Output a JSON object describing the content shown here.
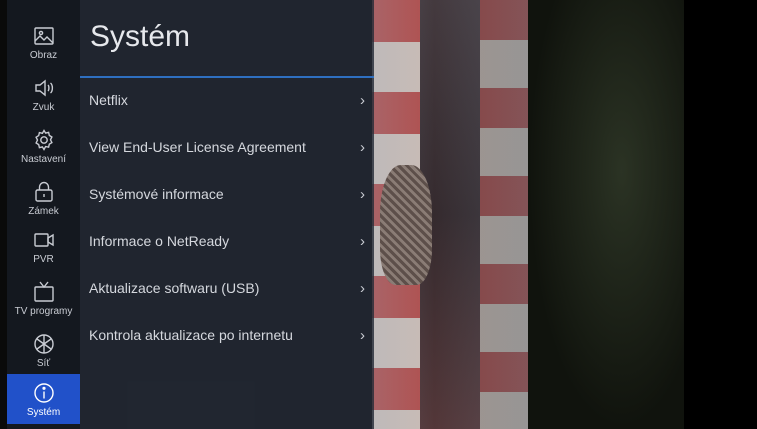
{
  "sidebar": {
    "items": [
      {
        "label": "Obraz",
        "icon": "picture-icon"
      },
      {
        "label": "Zvuk",
        "icon": "speaker-icon"
      },
      {
        "label": "Nastavení",
        "icon": "gear-icon"
      },
      {
        "label": "Zámek",
        "icon": "lock-icon"
      },
      {
        "label": "PVR",
        "icon": "camera-icon"
      },
      {
        "label": "TV programy",
        "icon": "tv-icon"
      },
      {
        "label": "Síť",
        "icon": "network-icon"
      },
      {
        "label": "Systém",
        "icon": "info-icon"
      }
    ],
    "active_index": 7
  },
  "panel": {
    "title": "Systém",
    "items": [
      {
        "label": "Netflix",
        "chevron": "›"
      },
      {
        "label": "View End-User License Agreement",
        "chevron": "›"
      },
      {
        "label": "Systémové informace",
        "chevron": "›"
      },
      {
        "label": "Informace o NetReady",
        "chevron": "›"
      },
      {
        "label": "Aktualizace softwaru (USB)",
        "chevron": "›"
      },
      {
        "label": "Kontrola aktualizace po internetu",
        "chevron": "›"
      }
    ]
  },
  "colors": {
    "accent": "#2151c9",
    "divider": "#2e6fc0"
  }
}
